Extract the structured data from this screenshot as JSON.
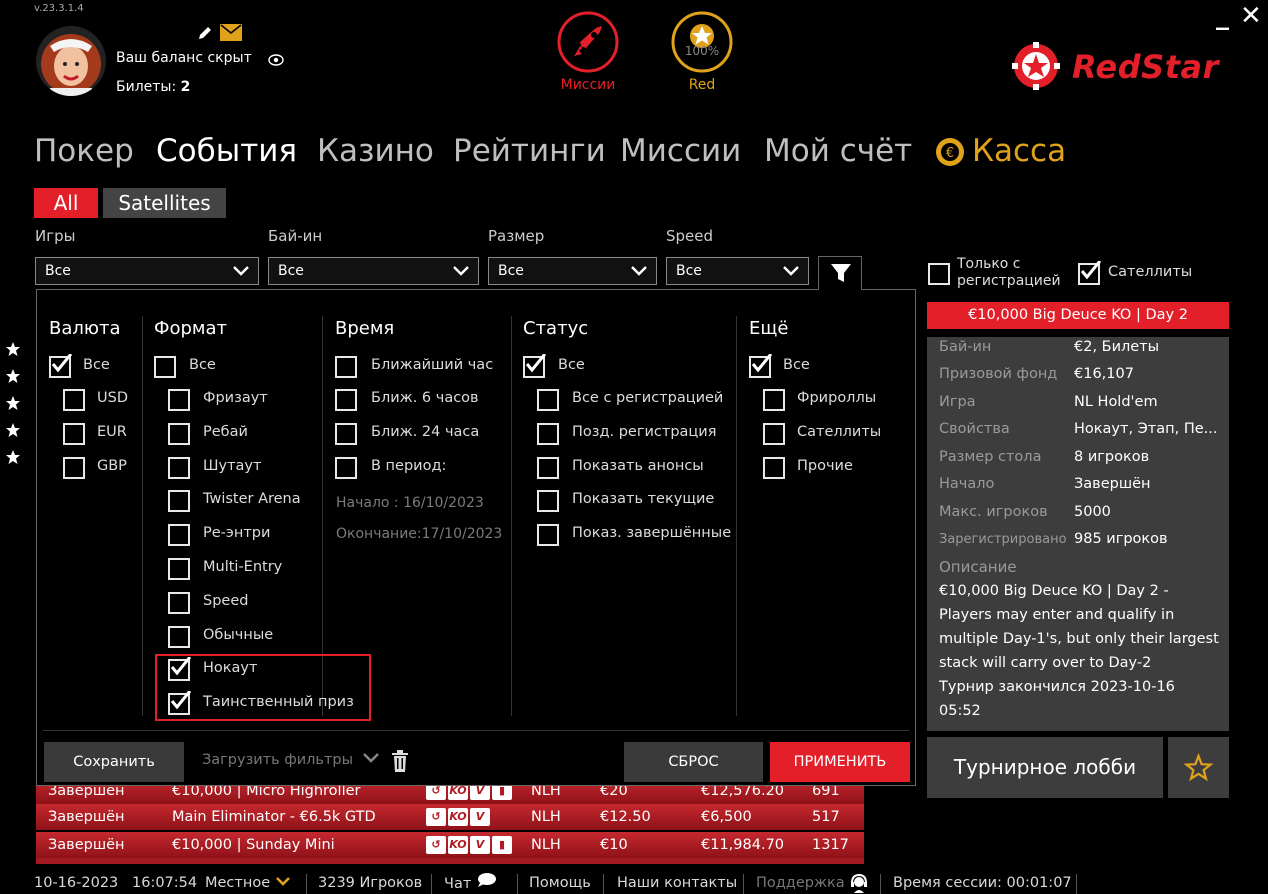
{
  "app": {
    "version": "v.23.3.1.4",
    "logo": "RedStar",
    "colors": {
      "accent": "#e3202a",
      "gold": "#e0a21a",
      "panel_gray": "#3d3d3d"
    }
  },
  "header": {
    "balance_text": "Ваш баланс скрыт",
    "tickets_label": "Билеты:",
    "tickets_value": "2",
    "missions_label": "Миссии",
    "red_label": "Red",
    "red_progress": "100%"
  },
  "nav": [
    "Покер",
    "События",
    "Казино",
    "Рейтинги",
    "Миссии",
    "Мой счёт",
    "Касса"
  ],
  "tabs": [
    "All",
    "Satellites"
  ],
  "filters": {
    "labels": [
      "Игры",
      "Бай-ин",
      "Размер",
      "Speed"
    ],
    "values": [
      "Все",
      "Все",
      "Все",
      "Все"
    ]
  },
  "panel": {
    "currency": {
      "title": "Валюта",
      "items": [
        "Все",
        "USD",
        "EUR",
        "GBP"
      ]
    },
    "format": {
      "title": "Формат",
      "items": [
        "Все",
        "Фризаут",
        "Ребай",
        "Шутаут",
        "Twister Arena",
        "Ре-энтри",
        "Multi-Entry",
        "Speed",
        "Обычные",
        "Нокаут",
        "Таинственный приз"
      ]
    },
    "time": {
      "title": "Время",
      "items": [
        "Ближайший час",
        "Ближ. 6 часов",
        "Ближ. 24 часа",
        "В период:"
      ],
      "start": "Начало : 16/10/2023",
      "end": "Окончание:17/10/2023"
    },
    "status": {
      "title": "Статус",
      "items": [
        "Все",
        "Все с регистрацией",
        "Позд. регистрация",
        "Показать анонсы",
        "Показать текущие",
        "Показ. завершённые"
      ]
    },
    "more": {
      "title": "Ещё",
      "items": [
        "Все",
        "Фрироллы",
        "Сателлиты",
        "Прочие"
      ]
    },
    "save": "Сохранить",
    "load_filters": "Загрузить фильтры",
    "reset": "СБРОС",
    "apply": "ПРИМЕНИТЬ"
  },
  "rows": [
    {
      "status": "Завершён",
      "name": "€10,000 | Micro Highroller",
      "game": "NLH",
      "buyin": "€20",
      "prize": "€12,576.20",
      "players": "691"
    },
    {
      "status": "Завершён",
      "name": "Main Eliminator - €6.5k GTD",
      "game": "NLH",
      "buyin": "€12.50",
      "prize": "€6,500",
      "players": "517"
    },
    {
      "status": "Завершён",
      "name": "€10,000 | Sunday Mini",
      "game": "NLH",
      "buyin": "€10",
      "prize": "€11,984.70",
      "players": "1317"
    }
  ],
  "badges": {
    "ko": "KO",
    "v": "V"
  },
  "side": {
    "only_reg": "Только с регистрацией",
    "only_reg_line1": "Только с",
    "only_reg_line2": "регистрацией",
    "satellites": "Сателлиты",
    "title": "€10,000 Big Deuce KO | Day 2",
    "info": [
      {
        "k": "Бай-ин",
        "v": "€2, Билеты"
      },
      {
        "k": "Призовой фонд",
        "v": "€16,107"
      },
      {
        "k": "Игра",
        "v": "NL Hold'em"
      },
      {
        "k": "Свойства",
        "v": "Нокаут, Этап, Пе..."
      },
      {
        "k": "Размер стола",
        "v": "8 игроков"
      },
      {
        "k": "Начало",
        "v": "Завершён"
      },
      {
        "k": "Макс. игроков",
        "v": "5000"
      },
      {
        "k": "Зарегистрировано",
        "v": "985 игроков"
      }
    ],
    "desc_label": "Описание",
    "desc": [
      "€10,000 Big Deuce KO | Day 2 -",
      "Players may enter and qualify in",
      "multiple Day-1's, but only their largest",
      "stack will carry over to Day-2",
      "Турнир закончился 2023-10-16 05:52"
    ],
    "lobby_button": "Турнирное лобби"
  },
  "status_bar": {
    "date": "10-16-2023",
    "time": "16:07:54",
    "tz": "Местное",
    "players": "3239 Игроков",
    "chat": "Чат",
    "help": "Помощь",
    "contacts": "Наши контакты",
    "support": "Поддержка",
    "session": "Время сессии: 00:01:07"
  }
}
